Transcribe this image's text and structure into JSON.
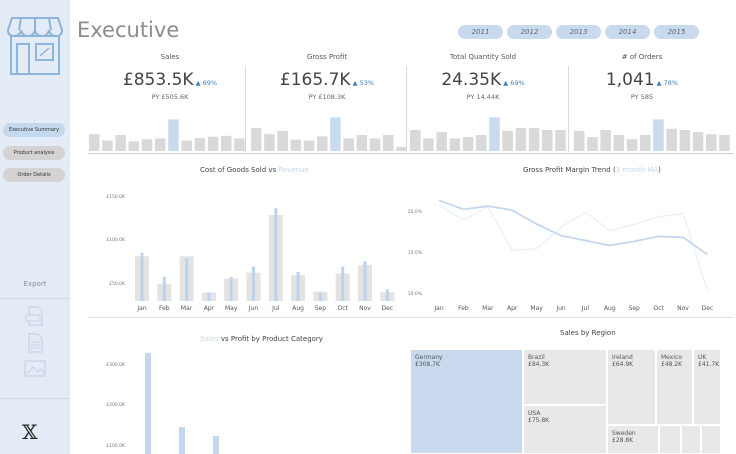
{
  "sidebar": {
    "nav": [
      "Executive Summary",
      "Product analysis",
      "Order Details"
    ],
    "export_label": "Export",
    "icons": [
      "storefront-icon",
      "pdf-export-icon",
      "ppt-export-icon",
      "image-export-icon",
      "x-logo-icon"
    ]
  },
  "header": {
    "title": "Executive",
    "years": [
      "2011",
      "2012",
      "2013",
      "2014",
      "2015"
    ]
  },
  "kpis": [
    {
      "title": "Sales",
      "value": "£853.5K",
      "delta": "▲ 69%",
      "py": "PY £505.6K",
      "bars": [
        0.4,
        0.25,
        0.38,
        0.23,
        0.28,
        0.3,
        0.75,
        0.25,
        0.31,
        0.34,
        0.36,
        0.3
      ]
    },
    {
      "title": "Gross Profit",
      "value": "£165.7K",
      "delta": "▲ 53%",
      "py": "PY £108.3K",
      "bars": [
        0.55,
        0.4,
        0.48,
        0.27,
        0.25,
        0.35,
        0.8,
        0.3,
        0.38,
        0.3,
        0.38,
        0.1
      ]
    },
    {
      "title": "Total Quantity Sold",
      "value": "24.35K",
      "delta": "▲ 69%",
      "py": "PY 14.44K",
      "bars": [
        0.5,
        0.3,
        0.45,
        0.3,
        0.33,
        0.38,
        0.8,
        0.48,
        0.55,
        0.55,
        0.5,
        0.5
      ]
    },
    {
      "title": "# of Orders",
      "value": "1,041",
      "delta": "▲ 78%",
      "py": "PY 585",
      "bars": [
        0.48,
        0.33,
        0.5,
        0.38,
        0.28,
        0.38,
        0.75,
        0.53,
        0.5,
        0.45,
        0.4,
        0.38
      ]
    }
  ],
  "cogs_chart": {
    "title_main": "Cost of Goods Sold vs ",
    "title_muted": "Revenue",
    "y_ticks": [
      "£150.0K",
      "£100.0K",
      "£50.0K"
    ],
    "months": [
      "Jan",
      "Feb",
      "Mar",
      "Apr",
      "May",
      "Jun",
      "Jul",
      "Aug",
      "Sep",
      "Oct",
      "Nov",
      "Dec"
    ]
  },
  "margin_chart": {
    "title_main": "Gross Profit Margin Trend (",
    "title_muted": "3 month MA",
    "title_end": ")",
    "y_ticks": [
      "20.0%",
      "15.0%",
      "10.0%"
    ],
    "months": [
      "Jan",
      "Feb",
      "Mar",
      "Apr",
      "May",
      "Jun",
      "Jul",
      "Aug",
      "Sep",
      "Oct",
      "Nov",
      "Dec"
    ]
  },
  "category_chart": {
    "title_muted": "Sales",
    "title_main": " vs Profit by Product Category",
    "y_ticks": [
      "£300.0K",
      "£200.0K",
      "£100.0K"
    ]
  },
  "region_chart": {
    "title": "Sales by Region",
    "cells": [
      {
        "name": "Germany",
        "value": "£308.7K"
      },
      {
        "name": "Brazil",
        "value": "£84.3K"
      },
      {
        "name": "USA",
        "value": "£75.8K"
      },
      {
        "name": "Ireland",
        "value": "£64.9K"
      },
      {
        "name": "Mexico",
        "value": "£48.2K"
      },
      {
        "name": "UK",
        "value": "£41.7K"
      },
      {
        "name": "Sweden",
        "value": "£28.8K"
      }
    ]
  },
  "colors": {
    "highlight": "#c9daee",
    "bar_gray": "#d9d9d9",
    "accent": "#3f7fc1",
    "sidebar": "#e3ecf6"
  }
}
